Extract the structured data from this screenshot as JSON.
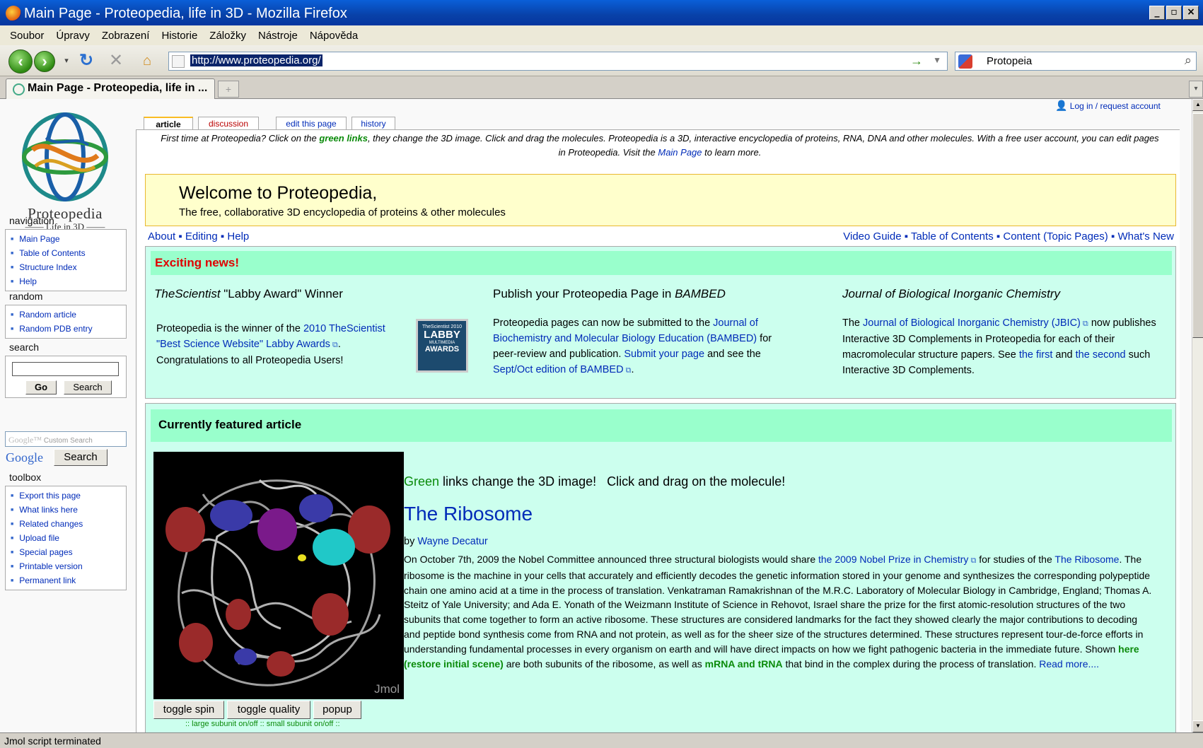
{
  "window": {
    "title": "Main Page - Proteopedia, life in 3D - Mozilla Firefox",
    "min": "_",
    "max": "×"
  },
  "menu": [
    "Soubor",
    "Úpravy",
    "Zobrazení",
    "Historie",
    "Záložky",
    "Nástroje",
    "Nápověda"
  ],
  "nav": {
    "url": "http://www.proteopedia.org/",
    "search_value": "Protopeia"
  },
  "tab": {
    "title": "Main Page - Proteopedia, life in ..."
  },
  "status": "Jmol script terminated",
  "sidebar": {
    "logo": {
      "wordmark": "Proteopedia",
      "tagline": "Life in 3D"
    },
    "navigation": {
      "title": "navigation",
      "items": [
        "Main Page",
        "Table of Contents",
        "Structure Index",
        "Help"
      ]
    },
    "random": {
      "title": "random",
      "items": [
        "Random article",
        "Random PDB entry"
      ]
    },
    "search": {
      "title": "search",
      "go": "Go",
      "search": "Search"
    },
    "google": {
      "placeholder": "Custom Search",
      "brand": "Google",
      "button": "Search"
    },
    "toolbox": {
      "title": "toolbox",
      "items": [
        "Export this page",
        "What links here",
        "Related changes",
        "Upload file",
        "Special pages",
        "Printable version",
        "Permanent link"
      ]
    }
  },
  "login": "Log in / request account",
  "page_tabs": [
    "article",
    "discussion",
    "edit this page",
    "history"
  ],
  "intro": {
    "part1": "First time at Proteopedia? Click on the",
    "green": "green links",
    "part2": ", they change the 3D image. Click and drag the molecules. Proteopedia is a 3D, interactive encyclopedia of proteins, RNA, DNA and other molecules. With a free user account, you can edit pages in Proteopedia. Visit the",
    "link": "Main Page",
    "part3": "to learn more."
  },
  "welcome": {
    "title": "Welcome to Proteopedia,",
    "subtitle": "The free, collaborative 3D encyclopedia of proteins & other molecules"
  },
  "links_left": [
    "About",
    "Editing",
    "Help"
  ],
  "links_right": [
    "Video Guide",
    "Table of Contents",
    "Content (Topic Pages)",
    "What's New"
  ],
  "news": {
    "heading": "Exciting news!",
    "col1": {
      "title_i": "TheScientist",
      "title_rest": " \"Labby Award\" Winner",
      "t1": "Proteopedia is the winner of the",
      "link": "2010 TheScientist \"Best Science Website\" Labby Awards",
      "t2": ". Congratulations to all Proteopedia Users!"
    },
    "badge": {
      "top": "TheScientist 2010",
      "main": "LABBY",
      "sub": "MULTIMEDIA",
      "awards": "AWARDS"
    },
    "col2": {
      "title": "Publish your Proteopedia Page in",
      "title_i": "BAMBED",
      "t1": "Proteopedia pages can now be submitted to the",
      "link1": "Journal of Biochemistry and Molecular Biology Education (BAMBED)",
      "t2": "for peer-review and publication.",
      "link2": "Submit your page",
      "t3": "and see the",
      "link3": "Sept/Oct edition of BAMBED",
      "t4": "."
    },
    "col3": {
      "title": "Journal of Biological Inorganic Chemistry",
      "t1": "The",
      "link1": "Journal of Biological Inorganic Chemistry (JBIC)",
      "t2": "now publishes Interactive 3D Complements in Proteopedia for each of their macromolecular structure papers. See",
      "link2": "the first",
      "t3": "and",
      "link4": "the second",
      "t4": "such Interactive 3D Complements."
    }
  },
  "featured": {
    "heading": "Currently featured article",
    "jmol": "Jmol",
    "buttons": [
      "toggle spin",
      "toggle quality",
      "popup"
    ],
    "subunits": ":: large subunit on/off :: small subunit on/off ::",
    "tagline_green": "Green",
    "tagline_rest": " links change the 3D image!   Click and drag on the molecule!",
    "title": "The Ribosome",
    "by": "by",
    "author": "Wayne Decatur",
    "p1": "On October 7th, 2009 the Nobel Committee announced three structural biologists would share",
    "link_nobel": "the 2009 Nobel Prize in Chemistry",
    "p2": "for studies of the",
    "link_ribo": "The Ribosome",
    "p3": ". The ribosome is the machine in your cells that accurately and efficiently decodes the genetic information stored in your genome and synthesizes the corresponding polypeptide chain one amino acid at a time in the process of translation. Venkatraman Ramakrishnan of the M.R.C. Laboratory of Molecular Biology in Cambridge, England; Thomas A. Steitz of Yale University; and Ada E. Yonath of the Weizmann Institute of Science in Rehovot, Israel share the prize for the first atomic-resolution structures of the two subunits that come together to form an active ribosome. These structures are considered landmarks for the fact they showed clearly the major contributions to decoding and peptide bond synthesis come from RNA and not protein, as well as for the sheer size of the structures determined. These structures represent tour-de-force efforts in understanding fundamental processes in every organism on earth and will have direct impacts on how we fight pathogenic bacteria in the immediate future. Shown",
    "green1": "here (restore initial scene)",
    "p4": "are both subunits of the ribosome, as well as",
    "green2": "mRNA and tRNA",
    "p5": "that bind in the complex during the process of translation.",
    "readmore": "Read more...."
  }
}
